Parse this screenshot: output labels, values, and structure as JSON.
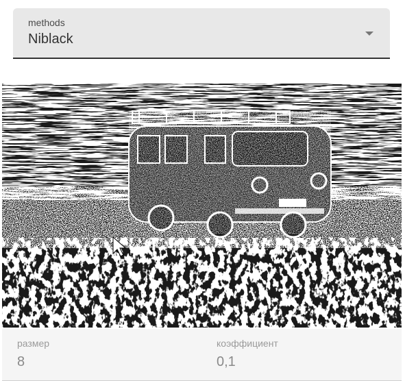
{
  "method_select": {
    "label": "methods",
    "value": "Niblack"
  },
  "image": {
    "description_icon": "binarized-photo-image"
  },
  "params": {
    "size": {
      "label": "размер",
      "value": "8"
    },
    "coefficient": {
      "label": "коэффициент",
      "value": "0,1"
    }
  },
  "colors": {
    "select_bg": "#e8e8e8",
    "select_underline": "#333333",
    "field_bg": "#f5f5f5"
  }
}
